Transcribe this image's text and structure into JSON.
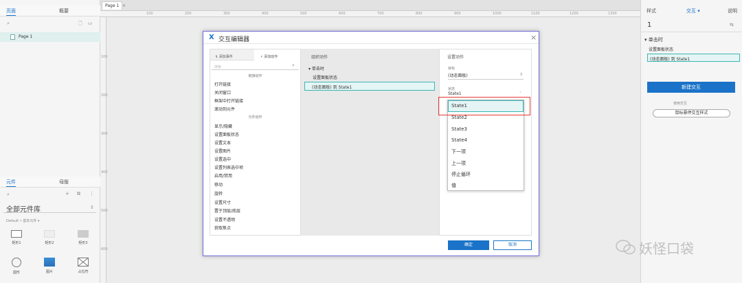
{
  "left_panel": {
    "tabs": [
      "页面",
      "概要"
    ],
    "page_item": "Page 1",
    "widget_tabs": [
      "元件",
      "母版"
    ],
    "library_title": "全部元件库",
    "library_default": "Default • 基本元件 ▾",
    "widgets": [
      "矩形1",
      "矩形2",
      "矩形3",
      "圆形",
      "图片",
      "占位符"
    ]
  },
  "canvas": {
    "page_tab": "Page 1",
    "ruler_h": [
      "100",
      "200",
      "300",
      "400",
      "500",
      "600",
      "700",
      "800",
      "900",
      "1000",
      "1100",
      "1200",
      "1300"
    ],
    "ruler_v": [
      "100",
      "200",
      "300",
      "400",
      "500",
      "600",
      "700"
    ]
  },
  "right_panel": {
    "tabs": [
      "样式",
      "交互 ▾",
      "说明"
    ],
    "page_number": "1",
    "event": "单击时",
    "action": "设置面板状态",
    "target": "(动态面板) 到 State1",
    "new_interaction": "新建交互",
    "hint": "使用交互",
    "style_button": "鼠标悬停交互样式"
  },
  "dialog": {
    "title": "交互编辑器",
    "col1": {
      "tabs": [
        "添加事件",
        "添加动作"
      ],
      "search_placeholder": "搜索",
      "group_link": "链接动作",
      "link_actions": [
        "打开链接",
        "关闭窗口",
        "框架中打开链接",
        "滚动到元件"
      ],
      "group_widget": "元件动作",
      "widget_actions": [
        "显示/隐藏",
        "设置面板状态",
        "设置文本",
        "设置图片",
        "设置选中",
        "设置列表选中项",
        "启用/禁用",
        "移动",
        "旋转",
        "设置尺寸",
        "置于顶层/底层",
        "设置不透明",
        "获取焦点"
      ]
    },
    "col2": {
      "title": "组织动作",
      "event": "单击时",
      "action": "设置面板状态",
      "target": "(动态面板) 到 State1"
    },
    "col3": {
      "title": "设置动作",
      "target_label": "目标",
      "target_value": "(动态面板)",
      "state_label": "状态",
      "state_value": "State1",
      "options": [
        "State1",
        "State2",
        "State3",
        "State4",
        "下一项",
        "上一项",
        "停止循环",
        "值"
      ]
    },
    "ok": "确定",
    "cancel": "取消"
  },
  "watermark": "妖怪口袋",
  "colors": {
    "accent": "#1a73c8",
    "selection": "#3bb5b5",
    "highlight_box": "#e53935"
  }
}
